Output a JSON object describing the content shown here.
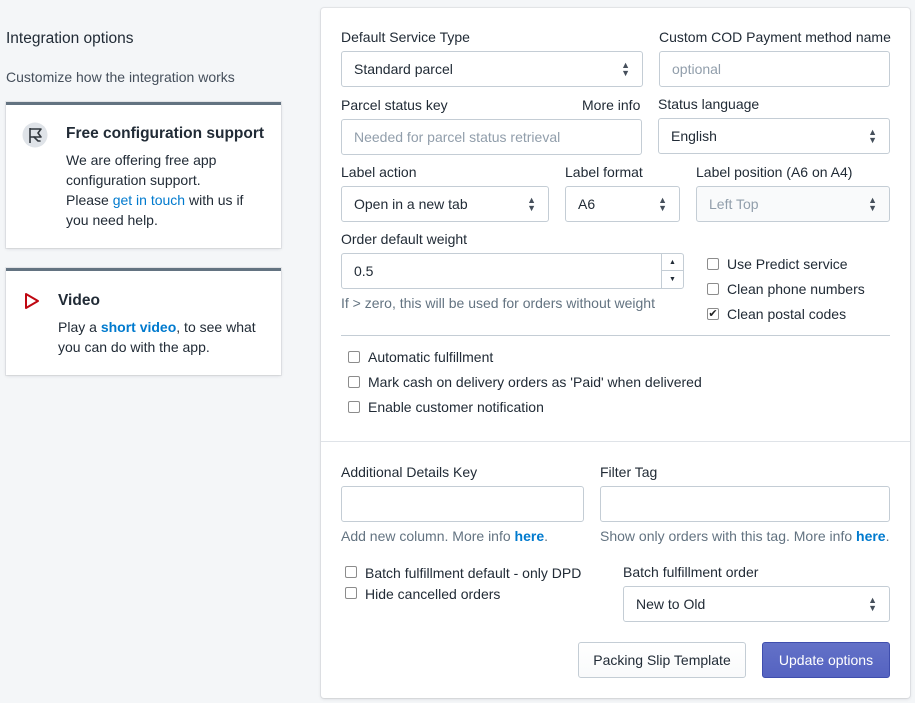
{
  "sidebar": {
    "title": "Integration options",
    "description": "Customize how the integration works",
    "support_card": {
      "title": "Free configuration support",
      "text_1": "We are offering free app",
      "text_2": "configuration support.",
      "text_3_before": "Please ",
      "text_3_link": "get in touch",
      "text_3_after": " with us if",
      "text_4": "you need help."
    },
    "video_card": {
      "title": "Video",
      "text_before": "Play a ",
      "text_link": "short video",
      "text_after": ", to see what",
      "text_2": "you can do with the app."
    }
  },
  "form": {
    "default_service_type": {
      "label": "Default Service Type",
      "value": "Standard parcel"
    },
    "cod_method_name": {
      "label": "Custom COD Payment method name",
      "placeholder": "optional"
    },
    "parcel_status_key": {
      "label": "Parcel status key",
      "more_info": "More info",
      "placeholder": "Needed for parcel status retrieval"
    },
    "status_language": {
      "label": "Status language",
      "value": "English"
    },
    "label_action": {
      "label": "Label action",
      "value": "Open in a new tab"
    },
    "label_format": {
      "label": "Label format",
      "value": "A6"
    },
    "label_position": {
      "label": "Label position (A6 on A4)",
      "value": "Left Top"
    },
    "order_default_weight": {
      "label": "Order default weight",
      "value": "0.5",
      "help": "If > zero, this will be used for orders without weight"
    },
    "checkboxes_right": [
      {
        "label": "Use Predict service",
        "checked": false
      },
      {
        "label": "Clean phone numbers",
        "checked": false
      },
      {
        "label": "Clean postal codes",
        "checked": true
      }
    ],
    "checkboxes_mid": [
      {
        "label": "Automatic fulfillment",
        "checked": false
      },
      {
        "label": "Mark cash on delivery orders as 'Paid' when delivered",
        "checked": false
      },
      {
        "label": "Enable customer notification",
        "checked": false
      }
    ],
    "additional_details_key": {
      "label": "Additional Details Key",
      "help_before": "Add new column. More info ",
      "help_link": "here",
      "help_after": "."
    },
    "filter_tag": {
      "label": "Filter Tag",
      "help_before": "Show only orders with this tag. More info ",
      "help_link": "here",
      "help_after": "."
    },
    "checkboxes_bottom": [
      {
        "label": "Batch fulfillment default - only DPD",
        "checked": false
      },
      {
        "label": "Hide cancelled orders",
        "checked": false
      }
    ],
    "batch_fulfillment_order": {
      "label": "Batch fulfillment order",
      "value": "New to Old"
    },
    "buttons": {
      "packing_slip": "Packing Slip Template",
      "update": "Update options"
    }
  },
  "icons": {
    "support": "flag-support-icon",
    "video": "play-icon",
    "select_caret": "select-caret-icon"
  },
  "colors": {
    "primary": "#5c6ac4",
    "link": "#007ace",
    "video_icon": "#bf0711"
  }
}
